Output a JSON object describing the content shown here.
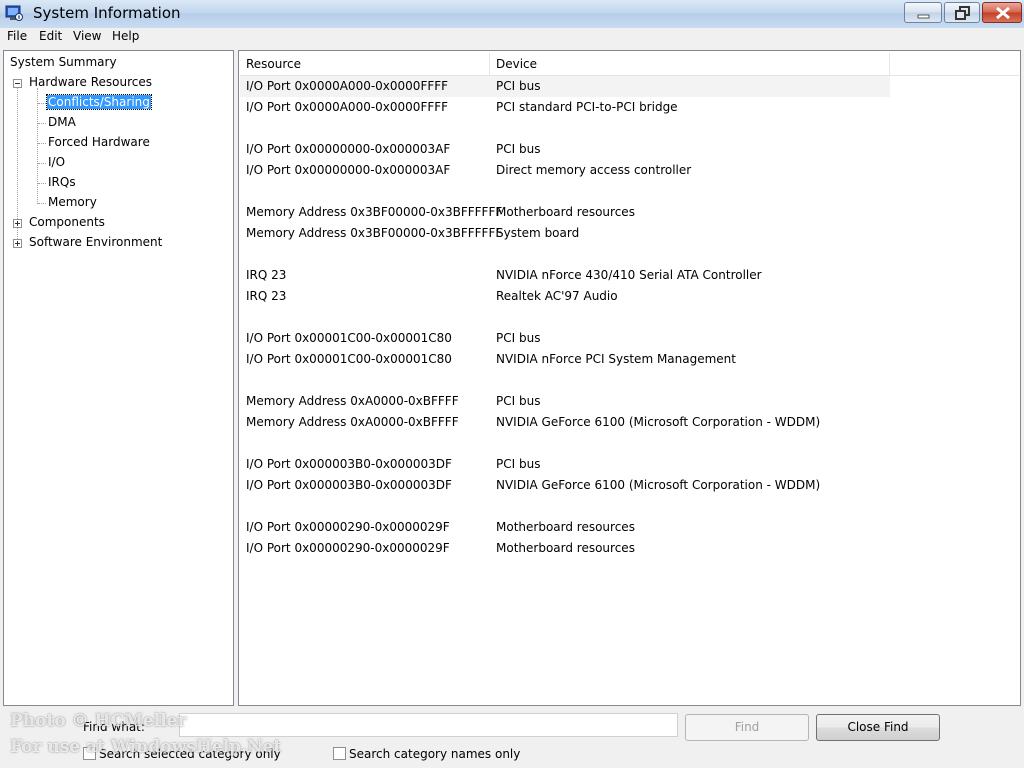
{
  "window": {
    "title": "System Information",
    "icon": "system-info-icon"
  },
  "menu": [
    "File",
    "Edit",
    "View",
    "Help"
  ],
  "tree": {
    "root": "System Summary",
    "hardware": "Hardware Resources",
    "hardware_children": [
      "Conflicts/Sharing",
      "DMA",
      "Forced Hardware",
      "I/O",
      "IRQs",
      "Memory"
    ],
    "components": "Components",
    "software": "Software Environment",
    "selected": "Conflicts/Sharing"
  },
  "table": {
    "columns": [
      "Resource",
      "Device"
    ],
    "rows": [
      [
        "I/O Port 0x0000A000-0x0000FFFF",
        "PCI bus"
      ],
      [
        "I/O Port 0x0000A000-0x0000FFFF",
        "PCI standard PCI-to-PCI bridge"
      ],
      [
        "",
        ""
      ],
      [
        "I/O Port 0x00000000-0x000003AF",
        "PCI bus"
      ],
      [
        "I/O Port 0x00000000-0x000003AF",
        "Direct memory access controller"
      ],
      [
        "",
        ""
      ],
      [
        "Memory Address 0x3BF00000-0x3BFFFFFF",
        "Motherboard resources"
      ],
      [
        "Memory Address 0x3BF00000-0x3BFFFFFF",
        "System board"
      ],
      [
        "",
        ""
      ],
      [
        "IRQ 23",
        "NVIDIA nForce 430/410 Serial ATA Controller"
      ],
      [
        "IRQ 23",
        "Realtek AC'97 Audio"
      ],
      [
        "",
        ""
      ],
      [
        "I/O Port 0x00001C00-0x00001C80",
        "PCI bus"
      ],
      [
        "I/O Port 0x00001C00-0x00001C80",
        "NVIDIA nForce PCI System Management"
      ],
      [
        "",
        ""
      ],
      [
        "Memory Address 0xA0000-0xBFFFF",
        "PCI bus"
      ],
      [
        "Memory Address 0xA0000-0xBFFFF",
        "NVIDIA GeForce 6100 (Microsoft Corporation - WDDM)"
      ],
      [
        "",
        ""
      ],
      [
        "I/O Port 0x000003B0-0x000003DF",
        "PCI bus"
      ],
      [
        "I/O Port 0x000003B0-0x000003DF",
        "NVIDIA GeForce 6100 (Microsoft Corporation - WDDM)"
      ],
      [
        "",
        ""
      ],
      [
        "I/O Port 0x00000290-0x0000029F",
        "Motherboard resources"
      ],
      [
        "I/O Port 0x00000290-0x0000029F",
        "Motherboard resources"
      ]
    ]
  },
  "find": {
    "label": "Find what:",
    "value": "",
    "find_button": "Find",
    "close_button": "Close Find",
    "check_selected": "Search selected category only",
    "check_names": "Search category names only"
  },
  "watermark": [
    "Photo © HCMeller",
    "For use at WindowsHelp.Net"
  ]
}
